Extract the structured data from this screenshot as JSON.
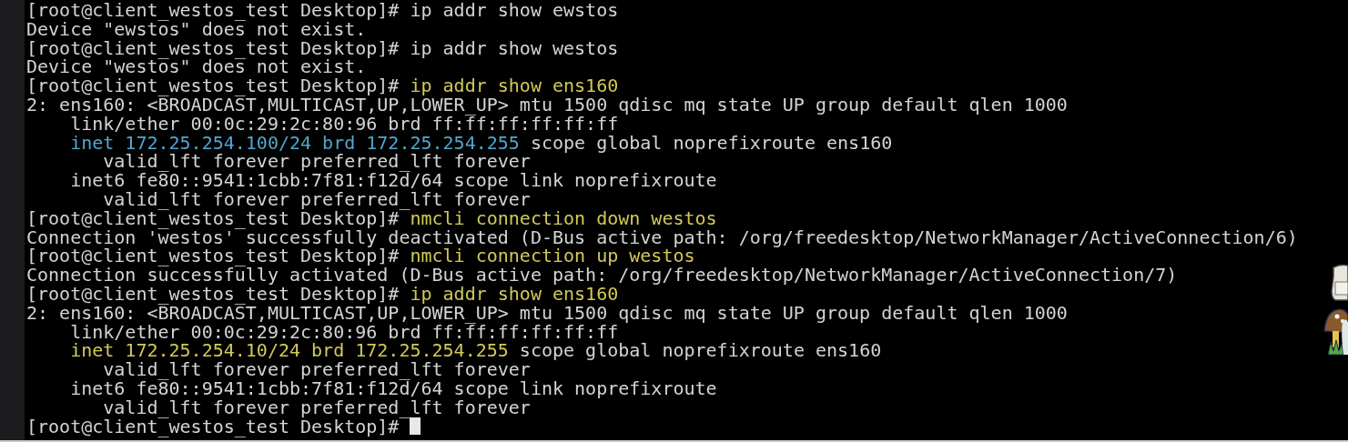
{
  "terminal": {
    "lines": [
      {
        "cursor": false,
        "segments": [
          {
            "text": "[root@client_westos_test Desktop]# ip addr show ewstos",
            "color": "#d4d4d4"
          }
        ]
      },
      {
        "cursor": false,
        "segments": [
          {
            "text": "Device \"ewstos\" does not exist.",
            "color": "#d4d4d4"
          }
        ]
      },
      {
        "cursor": false,
        "segments": [
          {
            "text": "[root@client_westos_test Desktop]# ip addr show westos",
            "color": "#d4d4d4"
          }
        ]
      },
      {
        "cursor": false,
        "segments": [
          {
            "text": "Device \"westos\" does not exist.",
            "color": "#d4d4d4"
          }
        ]
      },
      {
        "cursor": false,
        "segments": [
          {
            "text": "[root@client_westos_test Desktop]# ",
            "color": "#d4d4d4"
          },
          {
            "text": "ip addr show ens160",
            "color": "#d2c957"
          }
        ]
      },
      {
        "cursor": false,
        "segments": [
          {
            "text": "2: ens160: <BROADCAST,MULTICAST,UP,LOWER_UP> mtu 1500 qdisc mq state UP group default qlen 1000",
            "color": "#d4d4d4"
          }
        ]
      },
      {
        "cursor": false,
        "segments": [
          {
            "text": "    link/ether 00:0c:29:2c:80:96 brd ff:ff:ff:ff:ff:ff",
            "color": "#d4d4d4"
          }
        ]
      },
      {
        "cursor": false,
        "segments": [
          {
            "text": "    inet 172.25.254.100/24 brd 172.25.254.255",
            "color": "#52a6cf"
          },
          {
            "text": " scope global noprefixroute ens160",
            "color": "#d4d4d4"
          }
        ]
      },
      {
        "cursor": false,
        "segments": [
          {
            "text": "       valid_lft forever preferred_lft forever",
            "color": "#d4d4d4"
          }
        ]
      },
      {
        "cursor": false,
        "segments": [
          {
            "text": "    inet6 fe80::9541:1cbb:7f81:f12d/64 scope link noprefixroute",
            "color": "#d4d4d4"
          }
        ]
      },
      {
        "cursor": false,
        "segments": [
          {
            "text": "       valid_lft forever preferred_lft forever",
            "color": "#d4d4d4"
          }
        ]
      },
      {
        "cursor": false,
        "segments": [
          {
            "text": "[root@client_westos_test Desktop]# ",
            "color": "#d4d4d4"
          },
          {
            "text": "nmcli connection down westos",
            "color": "#d2c957"
          }
        ]
      },
      {
        "cursor": false,
        "segments": [
          {
            "text": "Connection 'westos' successfully deactivated (D-Bus active path: /org/freedesktop/NetworkManager/ActiveConnection/6)",
            "color": "#d4d4d4"
          }
        ]
      },
      {
        "cursor": false,
        "segments": [
          {
            "text": "[root@client_westos_test Desktop]# ",
            "color": "#d4d4d4"
          },
          {
            "text": "nmcli connection up westos",
            "color": "#d2c957"
          }
        ]
      },
      {
        "cursor": false,
        "segments": [
          {
            "text": "Connection successfully activated (D-Bus active path: /org/freedesktop/NetworkManager/ActiveConnection/7)",
            "color": "#d4d4d4"
          }
        ]
      },
      {
        "cursor": false,
        "segments": [
          {
            "text": "[root@client_westos_test Desktop]# ",
            "color": "#d4d4d4"
          },
          {
            "text": "ip addr show ens160",
            "color": "#d2c957"
          }
        ]
      },
      {
        "cursor": false,
        "segments": [
          {
            "text": "2: ens160: <BROADCAST,MULTICAST,UP,LOWER_UP> mtu 1500 qdisc mq state UP group default qlen 1000",
            "color": "#d4d4d4"
          }
        ]
      },
      {
        "cursor": false,
        "segments": [
          {
            "text": "    link/ether 00:0c:29:2c:80:96 brd ff:ff:ff:ff:ff:ff",
            "color": "#d4d4d4"
          }
        ]
      },
      {
        "cursor": false,
        "segments": [
          {
            "text": "    inet 172.25.254.10/24 brd 172.25.254.255",
            "color": "#d2c957"
          },
          {
            "text": " scope global noprefixroute ens160",
            "color": "#d4d4d4"
          }
        ]
      },
      {
        "cursor": false,
        "segments": [
          {
            "text": "       valid_lft forever preferred_lft forever",
            "color": "#d4d4d4"
          }
        ]
      },
      {
        "cursor": false,
        "segments": [
          {
            "text": "    inet6 fe80::9541:1cbb:7f81:f12d/64 scope link noprefixroute",
            "color": "#d4d4d4"
          }
        ]
      },
      {
        "cursor": false,
        "segments": [
          {
            "text": "       valid_lft forever preferred_lft forever",
            "color": "#d4d4d4"
          }
        ]
      },
      {
        "cursor": true,
        "segments": [
          {
            "text": "[root@client_westos_test Desktop]# ",
            "color": "#d4d4d4"
          }
        ]
      }
    ]
  }
}
